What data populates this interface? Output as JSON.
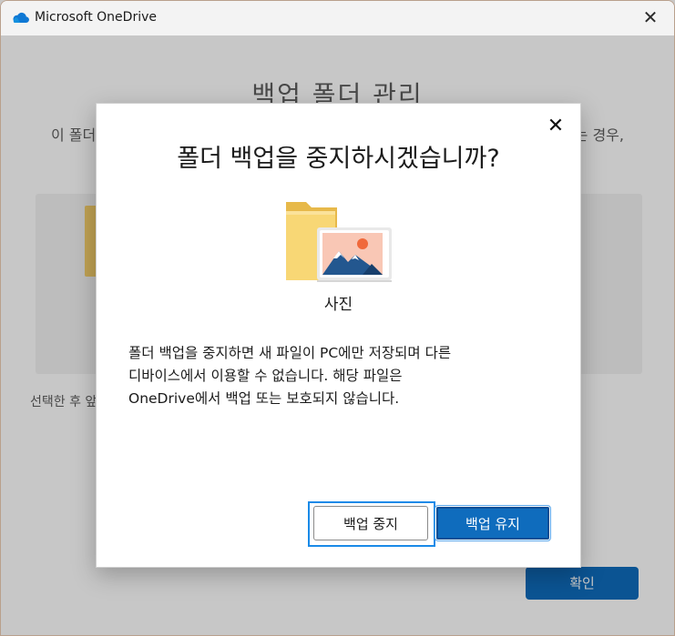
{
  "window": {
    "title": "Microsoft OneDrive",
    "close_glyph": "✕"
  },
  "background": {
    "title": "백업 폴더 관리",
    "description_left": "이 폴더",
    "description_right": "는 경우,",
    "selected_text": "선택한 후 앞",
    "confirm_label": "확인"
  },
  "dialog": {
    "title": "폴더 백업을 중지하시겠습니까?",
    "close_glyph": "✕",
    "folder_label": "사진",
    "message_lines": [
      "폴더 백업을 중지하면 새 파일이 PC에만 저장되며 다른",
      "디바이스에서 이용할 수 없습니다. 해당 파일은",
      "OneDrive에서 백업 또는 보호되지 않습니다."
    ],
    "stop_button": "백업 중지",
    "keep_button": "백업 유지"
  },
  "colors": {
    "accent": "#0f6cbd",
    "focus_ring": "#1a8ae8",
    "folder": "#f5cf6b"
  },
  "icons": {
    "app": "onedrive-cloud-icon",
    "illustration": "pictures-folder-icon"
  }
}
